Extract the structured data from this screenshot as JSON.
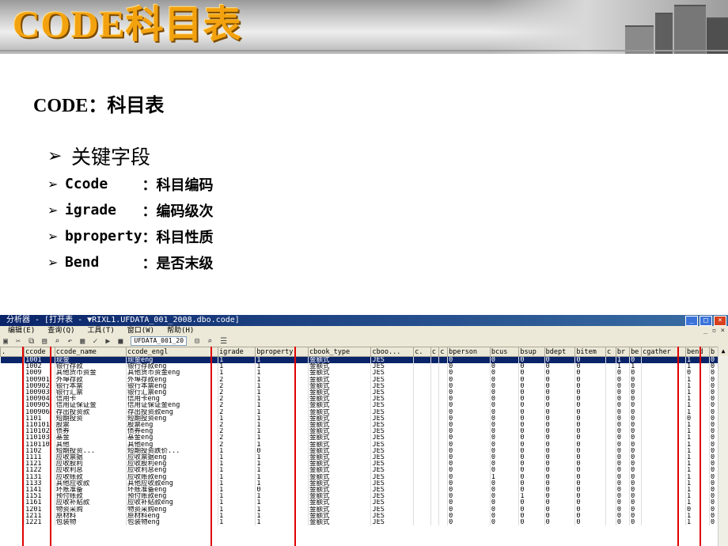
{
  "slide": {
    "banner_title": "CODE科目表",
    "heading": "CODE：科目表",
    "bullet_main": "关键字段",
    "fields": [
      {
        "name": "Ccode    ",
        "desc": "：科目编码"
      },
      {
        "name": "igrade   ",
        "desc": "：编码级次"
      },
      {
        "name": "bproperty",
        "desc": "：科目性质"
      },
      {
        "name": "Bend     ",
        "desc": "：是否末级"
      }
    ]
  },
  "screenshot": {
    "window_title": "分析器 - [打开表 - ▼RIXL1.UFDATA_001_2008.dbo.code]",
    "menu": [
      "编辑(E)",
      "查询(Q)",
      "工具(T)",
      "窗口(W)",
      "帮助(H)"
    ],
    "database": "UFDATA_001_20",
    "columns": [
      ".",
      "ccode",
      "ccode_name",
      "ccode_engl",
      "igrade",
      "bproperty",
      "cbook_type",
      "cboo...",
      "c.",
      "c",
      "c",
      "bperson",
      "bcus",
      "bsup",
      "bdept",
      "bitem",
      "c",
      "br",
      "be",
      "cgather",
      "bend",
      "b"
    ],
    "rows": [
      [
        "",
        "1001",
        "现金",
        "现金eng",
        "1",
        "1",
        "金额式",
        "JES",
        "",
        "",
        "",
        "0",
        "0",
        "0",
        "0",
        "0",
        "",
        "1",
        "0",
        "",
        "1",
        "0"
      ],
      [
        "",
        "1002",
        "银行存款",
        "银行存款eng",
        "1",
        "1",
        "金额式",
        "JES",
        "",
        "",
        "",
        "0",
        "0",
        "0",
        "0",
        "0",
        "",
        "1",
        "1",
        "",
        "1",
        "0"
      ],
      [
        "",
        "1009",
        "其他货币资金",
        "其他货币资金eng",
        "1",
        "1",
        "金额式",
        "JES",
        "",
        "",
        "",
        "0",
        "0",
        "0",
        "0",
        "0",
        "",
        "0",
        "0",
        "",
        "0",
        "0"
      ],
      [
        "",
        "100901",
        "外埠存款",
        "外埠存款eng",
        "2",
        "1",
        "金额式",
        "JES",
        "",
        "",
        "",
        "0",
        "0",
        "0",
        "0",
        "0",
        "",
        "0",
        "0",
        "",
        "1",
        "0"
      ],
      [
        "",
        "100902",
        "银行本票",
        "银行本票eng",
        "2",
        "1",
        "金额式",
        "JES",
        "",
        "",
        "",
        "0",
        "0",
        "0",
        "0",
        "0",
        "",
        "0",
        "0",
        "",
        "1",
        "0"
      ],
      [
        "",
        "100903",
        "银行汇票",
        "银行汇票eng",
        "2",
        "1",
        "金额式",
        "JES",
        "",
        "",
        "",
        "0",
        "0",
        "0",
        "0",
        "0",
        "",
        "0",
        "0",
        "",
        "1",
        "0"
      ],
      [
        "",
        "100904",
        "信用卡",
        "信用卡eng",
        "2",
        "1",
        "金额式",
        "JES",
        "",
        "",
        "",
        "0",
        "0",
        "0",
        "0",
        "0",
        "",
        "0",
        "0",
        "",
        "1",
        "0"
      ],
      [
        "",
        "100905",
        "信用证保证金",
        "信用证保证金eng",
        "2",
        "1",
        "金额式",
        "JES",
        "",
        "",
        "",
        "0",
        "0",
        "0",
        "0",
        "0",
        "",
        "0",
        "0",
        "",
        "1",
        "0"
      ],
      [
        "",
        "100906",
        "存出投资款",
        "存出投资款eng",
        "2",
        "1",
        "金额式",
        "JES",
        "",
        "",
        "",
        "0",
        "0",
        "0",
        "0",
        "0",
        "",
        "0",
        "0",
        "",
        "1",
        "0"
      ],
      [
        "",
        "1101",
        "短期投资",
        "短期投资eng",
        "1",
        "1",
        "金额式",
        "JES",
        "",
        "",
        "",
        "0",
        "0",
        "0",
        "0",
        "0",
        "",
        "0",
        "0",
        "",
        "0",
        "0"
      ],
      [
        "",
        "110101",
        "股票",
        "股票eng",
        "2",
        "1",
        "金额式",
        "JES",
        "",
        "",
        "",
        "0",
        "0",
        "0",
        "0",
        "0",
        "",
        "0",
        "0",
        "",
        "1",
        "0"
      ],
      [
        "",
        "110102",
        "债券",
        "债券eng",
        "2",
        "1",
        "金额式",
        "JES",
        "",
        "",
        "",
        "0",
        "0",
        "0",
        "0",
        "0",
        "",
        "0",
        "0",
        "",
        "1",
        "0"
      ],
      [
        "",
        "110103",
        "基金",
        "基金eng",
        "2",
        "1",
        "金额式",
        "JES",
        "",
        "",
        "",
        "0",
        "0",
        "0",
        "0",
        "0",
        "",
        "0",
        "0",
        "",
        "1",
        "0"
      ],
      [
        "",
        "110110",
        "其他",
        "其他eng",
        "2",
        "1",
        "金额式",
        "JES",
        "",
        "",
        "",
        "0",
        "0",
        "0",
        "0",
        "0",
        "",
        "0",
        "0",
        "",
        "1",
        "0"
      ],
      [
        "",
        "1102",
        "短期投资...",
        "短期投资跌价...",
        "1",
        "0",
        "金额式",
        "JES",
        "",
        "",
        "",
        "0",
        "0",
        "0",
        "0",
        "0",
        "",
        "0",
        "0",
        "",
        "1",
        "0"
      ],
      [
        "",
        "1111",
        "应收票据",
        "应收票据eng",
        "1",
        "1",
        "金额式",
        "JES",
        "",
        "",
        "",
        "0",
        "0",
        "0",
        "0",
        "0",
        "",
        "0",
        "0",
        "",
        "1",
        "0"
      ],
      [
        "",
        "1121",
        "应收股利",
        "应收股利eng",
        "1",
        "1",
        "金额式",
        "JES",
        "",
        "",
        "",
        "0",
        "0",
        "0",
        "0",
        "0",
        "",
        "0",
        "0",
        "",
        "1",
        "0"
      ],
      [
        "",
        "1122",
        "应收利息",
        "应收利息eng",
        "1",
        "1",
        "金额式",
        "JES",
        "",
        "",
        "",
        "0",
        "0",
        "0",
        "0",
        "0",
        "",
        "0",
        "0",
        "",
        "1",
        "0"
      ],
      [
        "",
        "1131",
        "应收账款",
        "应收账款eng",
        "1",
        "1",
        "金额式",
        "JES",
        "",
        "",
        "",
        "0",
        "1",
        "0",
        "0",
        "0",
        "",
        "0",
        "0",
        "",
        "1",
        "0"
      ],
      [
        "",
        "1133",
        "其他应收款",
        "其他应收款eng",
        "1",
        "1",
        "金额式",
        "JES",
        "",
        "",
        "",
        "0",
        "0",
        "0",
        "0",
        "0",
        "",
        "0",
        "0",
        "",
        "1",
        "0"
      ],
      [
        "",
        "1141",
        "坏账准备",
        "坏账准备eng",
        "1",
        "0",
        "金额式",
        "JES",
        "",
        "",
        "",
        "0",
        "0",
        "0",
        "0",
        "0",
        "",
        "0",
        "0",
        "",
        "1",
        "0"
      ],
      [
        "",
        "1151",
        "预付账款",
        "预付账款eng",
        "1",
        "1",
        "金额式",
        "JES",
        "",
        "",
        "",
        "0",
        "0",
        "1",
        "0",
        "0",
        "",
        "0",
        "0",
        "",
        "1",
        "0"
      ],
      [
        "",
        "1161",
        "应收补贴款",
        "应收补贴款eng",
        "1",
        "1",
        "金额式",
        "JES",
        "",
        "",
        "",
        "0",
        "0",
        "0",
        "0",
        "0",
        "",
        "0",
        "0",
        "",
        "1",
        "0"
      ],
      [
        "",
        "1201",
        "物资采购",
        "物资采购eng",
        "1",
        "1",
        "金额式",
        "JES",
        "",
        "",
        "",
        "0",
        "0",
        "0",
        "0",
        "0",
        "",
        "0",
        "0",
        "",
        "0",
        "0"
      ],
      [
        "",
        "1211",
        "原材料",
        "原材料eng",
        "1",
        "1",
        "金额式",
        "JES",
        "",
        "",
        "",
        "0",
        "0",
        "0",
        "0",
        "0",
        "",
        "0",
        "0",
        "",
        "1",
        "0"
      ],
      [
        "",
        "1221",
        "包装物",
        "包装物eng",
        "1",
        "1",
        "金额式",
        "JES",
        "",
        "",
        "",
        "0",
        "0",
        "0",
        "0",
        "0",
        "",
        "0",
        "0",
        "",
        "1",
        "0"
      ]
    ]
  }
}
